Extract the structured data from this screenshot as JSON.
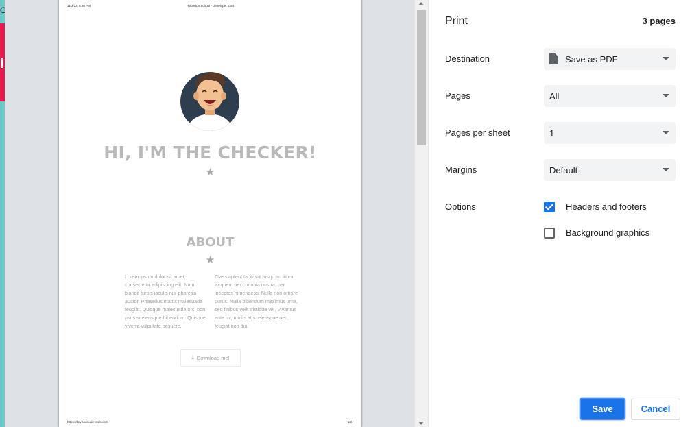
{
  "backdrop": {
    "fragment_top": "C",
    "fragment_mid": "I"
  },
  "preview": {
    "header_date": "11/3/23, 6:56 PM",
    "header_title": "Holberton School - Developer tools",
    "footer_url": "https://dev-tools.alx-tools.com",
    "footer_page": "1/3",
    "title": "HI, I'M THE CHECKER!",
    "star_icon": "★",
    "about_title": "ABOUT",
    "about_col1": "Lorem ipsum dolor sit amet, consectetur adipiscing elit. Nam blandit turpis iaculis nisl pharetra auctor. Phasellus mattis malesuada feugiat. Quisque malesuada orci non risus scelerisque bibendum. Quisque viverra vulputate posuere.",
    "about_col2": "Class aptent taciti sociosqu ad litora torquent per conubia nostra, per inceptos himenaeos. Nulla non ornare purus. Nulla bibendum maximus urna, sed finibus velit tristique vel. Vivamus ante mi, mollis at scelerisque nec, feugiat non dui.",
    "download_label": "Download me!"
  },
  "print_panel": {
    "title": "Print",
    "page_count": "3 pages",
    "destination": {
      "label": "Destination",
      "value": "Save as PDF"
    },
    "pages": {
      "label": "Pages",
      "value": "All"
    },
    "pages_per_sheet": {
      "label": "Pages per sheet",
      "value": "1"
    },
    "margins": {
      "label": "Margins",
      "value": "Default"
    },
    "options": {
      "label": "Options",
      "headers_footers": {
        "label": "Headers and footers",
        "checked": true
      },
      "background_graphics": {
        "label": "Background graphics",
        "checked": false
      }
    },
    "save_label": "Save",
    "cancel_label": "Cancel"
  },
  "colors": {
    "accent": "#1a73e8",
    "preview_bg": "#dee1e6",
    "select_bg": "#f1f3f4"
  }
}
